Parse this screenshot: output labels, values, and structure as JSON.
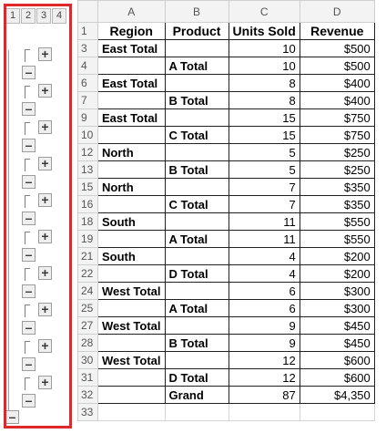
{
  "outline": {
    "levels": [
      "1",
      "2",
      "3",
      "4"
    ],
    "expand_symbol": "+",
    "collapse_symbol": "–"
  },
  "sheet": {
    "columns": [
      "A",
      "B",
      "C",
      "D"
    ],
    "rows": [
      {
        "n": "1",
        "a": "Region",
        "b": "Product",
        "c": "Units Sold",
        "d": "Revenue",
        "header": true
      },
      {
        "n": "3",
        "a": "East Total",
        "b": "",
        "c": "10",
        "d": "$500"
      },
      {
        "n": "4",
        "a": "",
        "b": "A Total",
        "c": "10",
        "d": "$500"
      },
      {
        "n": "6",
        "a": "East Total",
        "b": "",
        "c": "8",
        "d": "$400"
      },
      {
        "n": "7",
        "a": "",
        "b": "B Total",
        "c": "8",
        "d": "$400"
      },
      {
        "n": "9",
        "a": "East Total",
        "b": "",
        "c": "15",
        "d": "$750"
      },
      {
        "n": "10",
        "a": "",
        "b": "C Total",
        "c": "15",
        "d": "$750"
      },
      {
        "n": "12",
        "a": "North",
        "b": "",
        "c": "5",
        "d": "$250"
      },
      {
        "n": "13",
        "a": "",
        "b": "B Total",
        "c": "5",
        "d": "$250"
      },
      {
        "n": "15",
        "a": "North",
        "b": "",
        "c": "7",
        "d": "$350"
      },
      {
        "n": "16",
        "a": "",
        "b": "C Total",
        "c": "7",
        "d": "$350"
      },
      {
        "n": "18",
        "a": "South",
        "b": "",
        "c": "11",
        "d": "$550"
      },
      {
        "n": "19",
        "a": "",
        "b": "A Total",
        "c": "11",
        "d": "$550"
      },
      {
        "n": "21",
        "a": "South",
        "b": "",
        "c": "4",
        "d": "$200"
      },
      {
        "n": "22",
        "a": "",
        "b": "D Total",
        "c": "4",
        "d": "$200"
      },
      {
        "n": "24",
        "a": "West Total",
        "b": "",
        "c": "6",
        "d": "$300"
      },
      {
        "n": "25",
        "a": "",
        "b": "A Total",
        "c": "6",
        "d": "$300"
      },
      {
        "n": "27",
        "a": "West Total",
        "b": "",
        "c": "9",
        "d": "$450"
      },
      {
        "n": "28",
        "a": "",
        "b": "B Total",
        "c": "9",
        "d": "$450"
      },
      {
        "n": "30",
        "a": "West Total",
        "b": "",
        "c": "12",
        "d": "$600"
      },
      {
        "n": "31",
        "a": "",
        "b": "D Total",
        "c": "12",
        "d": "$600"
      },
      {
        "n": "32",
        "a": "",
        "b": "Grand",
        "c": "87",
        "d": "$4,350"
      },
      {
        "n": "33",
        "a": "",
        "b": "",
        "c": "",
        "d": "",
        "empty": true
      }
    ]
  },
  "colors": {
    "highlight_frame": "#e0282b",
    "header_fill": "#f3f3f3",
    "gridline": "#d4d4d4"
  }
}
